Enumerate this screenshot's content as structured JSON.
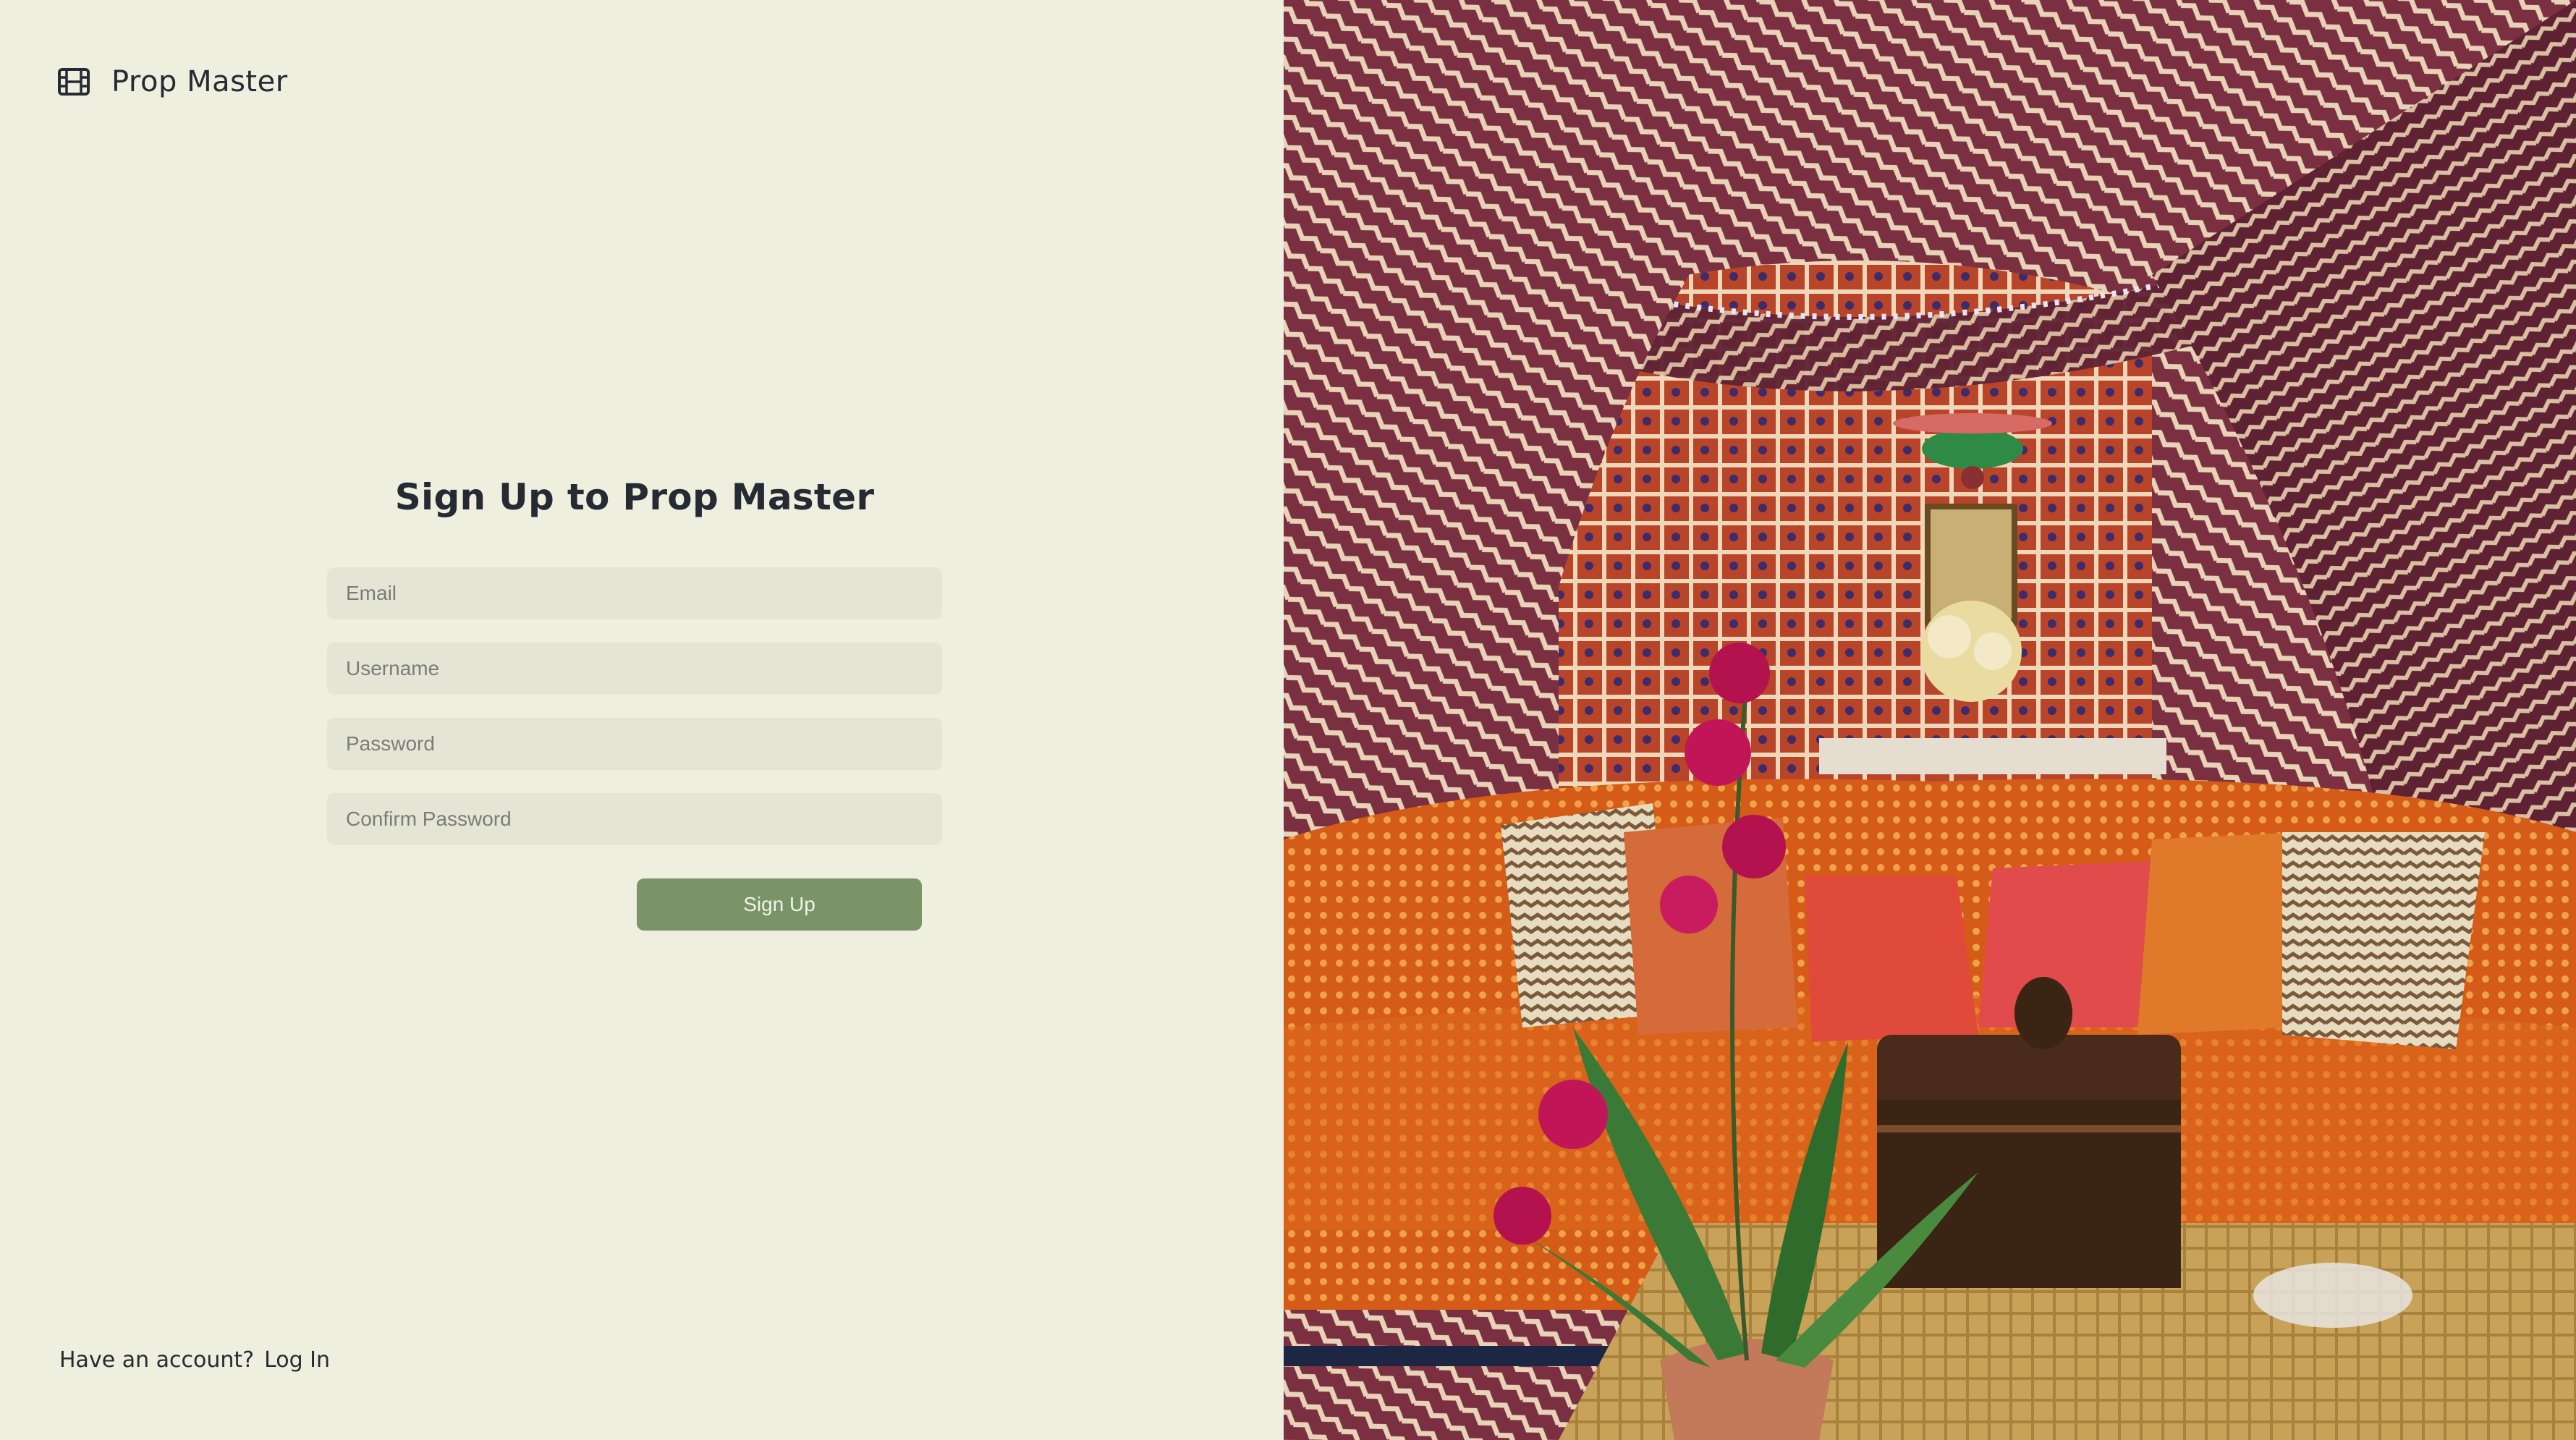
{
  "app": {
    "name": "Prop Master",
    "icon": "film-icon"
  },
  "signup": {
    "title": "Sign Up to Prop Master",
    "email_placeholder": "Email",
    "username_placeholder": "Username",
    "password_placeholder": "Password",
    "confirm_password_placeholder": "Confirm Password",
    "submit_label": "Sign Up"
  },
  "footer": {
    "prompt": "Have an account?",
    "login_label": "Log In"
  },
  "colors": {
    "background": "#eeefdf",
    "input_bg": "#e4e5d5",
    "button_bg": "#7a9468",
    "text": "#262b33"
  }
}
